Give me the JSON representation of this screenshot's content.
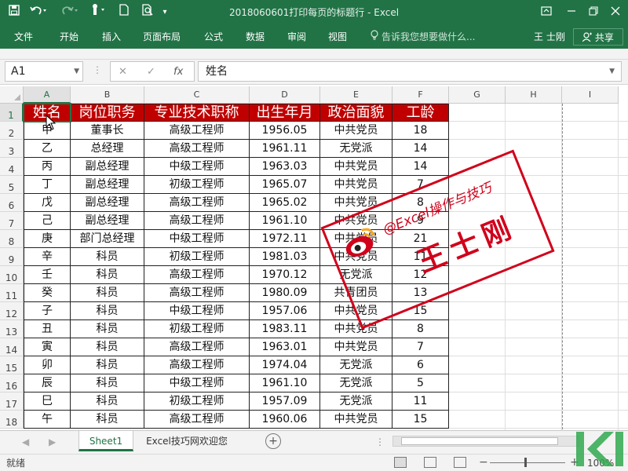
{
  "title_bar": {
    "document_title": "2018060601打印每页的标题行 - Excel",
    "icons": [
      "save-icon",
      "undo-icon",
      "redo-icon",
      "touch-mode-icon",
      "new-document-icon",
      "print-preview-icon",
      "customize-qat-icon",
      "ribbon-display-icon",
      "minimize-icon",
      "restore-icon",
      "close-icon"
    ]
  },
  "menu": {
    "items": [
      "文件",
      "开始",
      "插入",
      "页面布局",
      "公式",
      "数据",
      "审阅",
      "视图"
    ],
    "tell_me": "告诉我您想要做什么...",
    "user": "王 士刚",
    "share": "共享"
  },
  "formula_bar": {
    "name_box": "A1",
    "cancel_glyph": "✕",
    "enter_glyph": "✓",
    "fx_glyph": "fx",
    "content": "姓名"
  },
  "sheet": {
    "columns": [
      "A",
      "B",
      "C",
      "D",
      "E",
      "F",
      "G",
      "H",
      "I"
    ],
    "row_numbers": [
      "1",
      "2",
      "3",
      "4",
      "5",
      "6",
      "7",
      "8",
      "9",
      "10",
      "11",
      "12",
      "13",
      "14",
      "15",
      "16",
      "17",
      "18"
    ],
    "header": [
      "姓名",
      "岗位职务",
      "专业技术职称",
      "出生年月",
      "政治面貌",
      "工龄"
    ],
    "header_color": "#c00000",
    "rows": [
      [
        "甲",
        "董事长",
        "高级工程师",
        "1956.05",
        "中共党员",
        "18"
      ],
      [
        "乙",
        "总经理",
        "高级工程师",
        "1961.11",
        "无党派",
        "14"
      ],
      [
        "丙",
        "副总经理",
        "中级工程师",
        "1963.03",
        "中共党员",
        "14"
      ],
      [
        "丁",
        "副总经理",
        "初级工程师",
        "1965.07",
        "中共党员",
        "7"
      ],
      [
        "戊",
        "副总经理",
        "高级工程师",
        "1965.02",
        "中共党员",
        "8"
      ],
      [
        "己",
        "副总经理",
        "高级工程师",
        "1961.10",
        "中共党员",
        "9"
      ],
      [
        "庚",
        "部门总经理",
        "中级工程师",
        "1972.11",
        "中共党员",
        "21"
      ],
      [
        "辛",
        "科员",
        "初级工程师",
        "1981.03",
        "中共党员",
        "11"
      ],
      [
        "壬",
        "科员",
        "高级工程师",
        "1970.12",
        "无党派",
        "12"
      ],
      [
        "癸",
        "科员",
        "高级工程师",
        "1980.09",
        "共青团员",
        "13"
      ],
      [
        "子",
        "科员",
        "中级工程师",
        "1957.06",
        "中共党员",
        "15"
      ],
      [
        "丑",
        "科员",
        "初级工程师",
        "1983.11",
        "中共党员",
        "8"
      ],
      [
        "寅",
        "科员",
        "高级工程师",
        "1963.01",
        "中共党员",
        "7"
      ],
      [
        "卯",
        "科员",
        "高级工程师",
        "1974.04",
        "无党派",
        "6"
      ],
      [
        "辰",
        "科员",
        "中级工程师",
        "1961.10",
        "无党派",
        "5"
      ],
      [
        "巳",
        "科员",
        "初级工程师",
        "1957.09",
        "无党派",
        "11"
      ],
      [
        "午",
        "科员",
        "高级工程师",
        "1960.06",
        "中共党员",
        "15"
      ]
    ]
  },
  "stamp": {
    "line1": "@Excel操作与技巧",
    "line2": "王士刚",
    "color": "#d0021b"
  },
  "tabs": {
    "items": [
      "Sheet1",
      "Excel技巧网欢迎您"
    ],
    "active": "Sheet1",
    "add_glyph": "+"
  },
  "status": {
    "ready": "就绪",
    "zoom": "100%",
    "zoom_minus": "−",
    "zoom_plus": "+"
  },
  "accent_color": "#217346"
}
